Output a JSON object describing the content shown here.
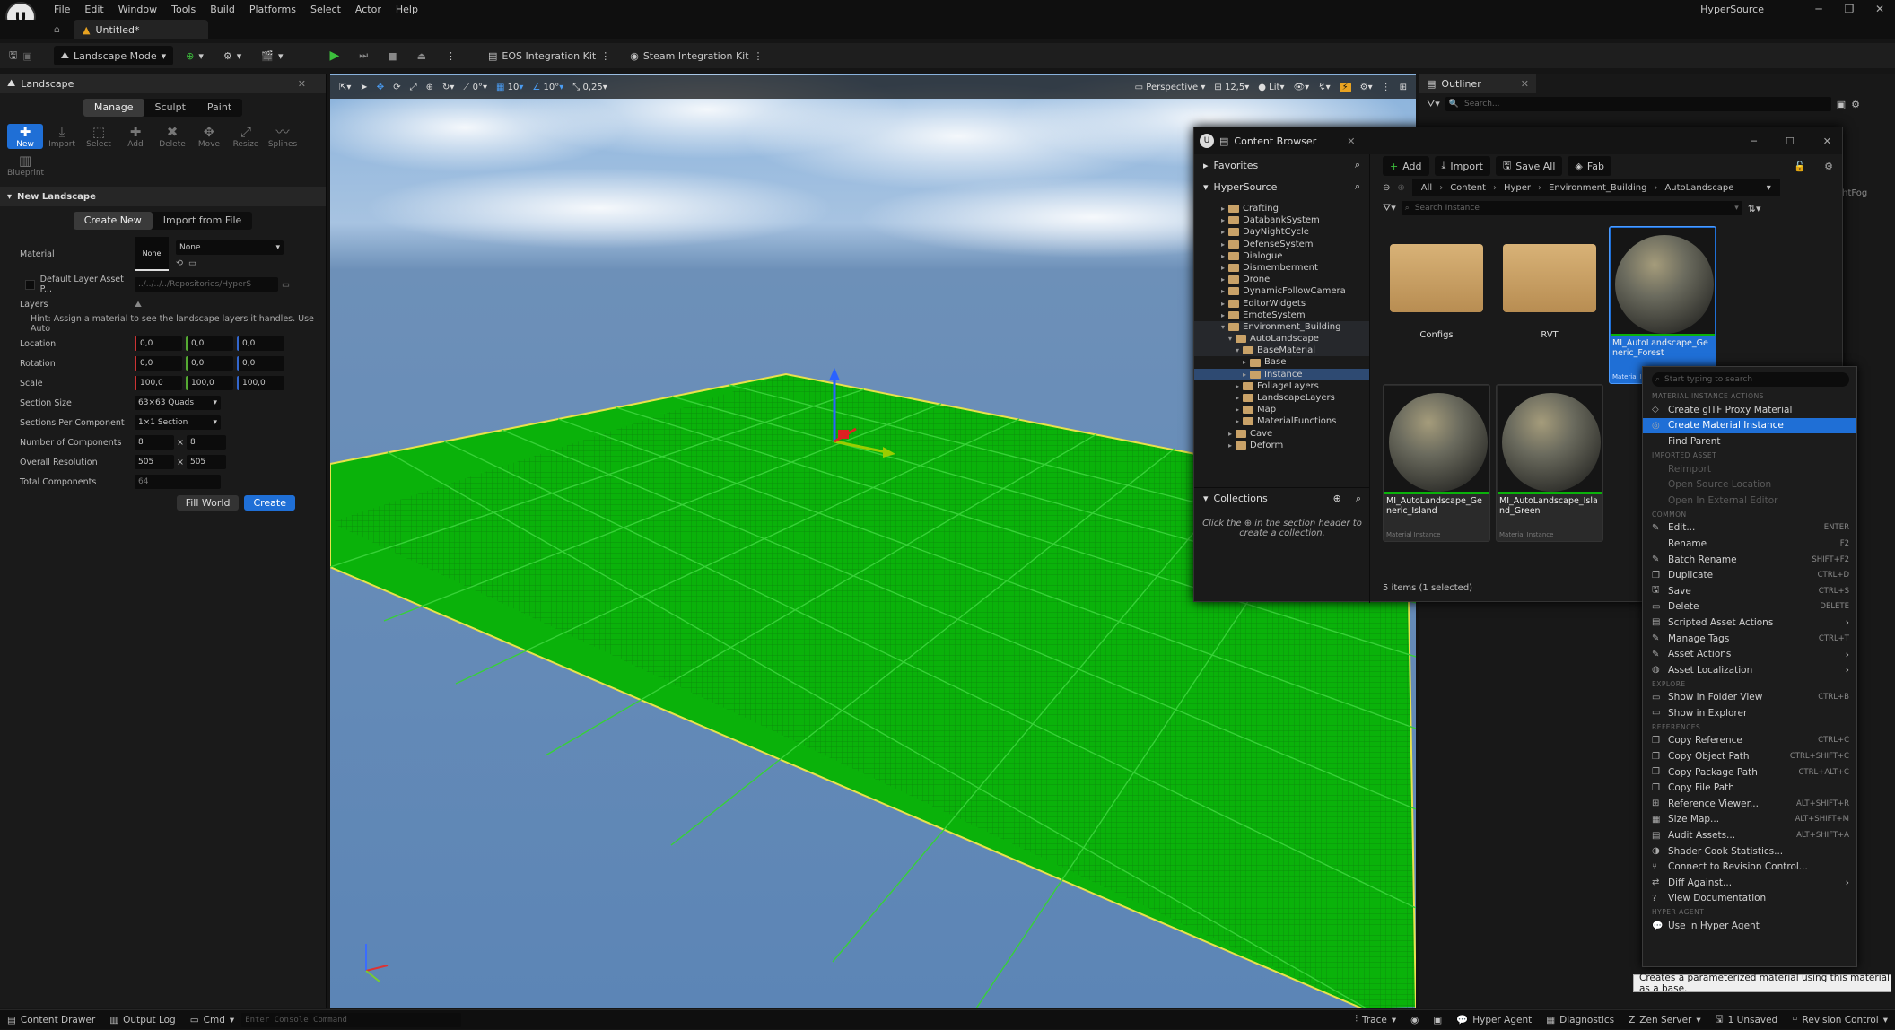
{
  "app": {
    "logo_text": "U",
    "project_name": "HyperSource",
    "doc_tab": "Untitled*"
  },
  "menu": [
    "File",
    "Edit",
    "Window",
    "Tools",
    "Build",
    "Platforms",
    "Select",
    "Actor",
    "Help"
  ],
  "toolbar": {
    "mode_label": "Landscape Mode",
    "eos_label": "EOS Integration Kit",
    "steam_label": "Steam Integration Kit"
  },
  "landscape_panel": {
    "tab_title": "Landscape",
    "modes": [
      "Manage",
      "Sculpt",
      "Paint"
    ],
    "tools": [
      "New",
      "Import",
      "Select",
      "Add",
      "Delete",
      "Move",
      "Resize",
      "Splines"
    ],
    "tool_blueprint": "Blueprint",
    "section_title": "New Landscape",
    "create_tabs": [
      "Create New",
      "Import from File"
    ],
    "material_label": "Material",
    "material_thumb": "None",
    "material_value": "None",
    "default_layer_label": "Default Layer Asset P...",
    "default_layer_path": "../../../../Repositories/HyperS",
    "layers_label": "Layers",
    "hint": "Hint: Assign a material to see the landscape layers it handles. Use Auto",
    "location_label": "Location",
    "location": [
      "0,0",
      "0,0",
      "0,0"
    ],
    "rotation_label": "Rotation",
    "rotation": [
      "0,0",
      "0,0",
      "0,0"
    ],
    "scale_label": "Scale",
    "scale": [
      "100,0",
      "100,0",
      "100,0"
    ],
    "section_size_label": "Section Size",
    "section_size": "63×63 Quads",
    "sections_per_comp_label": "Sections Per Component",
    "sections_per_comp": "1×1 Section",
    "num_components_label": "Number of Components",
    "num_components": [
      "8",
      "8"
    ],
    "overall_res_label": "Overall Resolution",
    "overall_res": [
      "505",
      "505"
    ],
    "total_components_label": "Total Components",
    "total_components": "64",
    "fill_world": "Fill World",
    "create": "Create"
  },
  "viewport": {
    "perspective": "Perspective",
    "lit": "Lit",
    "grid_snap": "10",
    "rot_snap": "10°",
    "scale_snap": "0,25",
    "fov": "12,5",
    "angle": "0°"
  },
  "outliner": {
    "title": "Outliner",
    "search_placeholder": "Search...",
    "partial_item": "ightFog"
  },
  "content_browser": {
    "title": "Content Browser",
    "favorites": "Favorites",
    "root": "HyperSource",
    "tree": [
      {
        "label": "Crafting",
        "depth": 0
      },
      {
        "label": "DatabankSystem",
        "depth": 0
      },
      {
        "label": "DayNightCycle",
        "depth": 0
      },
      {
        "label": "DefenseSystem",
        "depth": 0
      },
      {
        "label": "Dialogue",
        "depth": 0
      },
      {
        "label": "Dismemberment",
        "depth": 0
      },
      {
        "label": "Drone",
        "depth": 0
      },
      {
        "label": "DynamicFollowCamera",
        "depth": 0
      },
      {
        "label": "EditorWidgets",
        "depth": 0
      },
      {
        "label": "EmoteSystem",
        "depth": 0
      },
      {
        "label": "Environment_Building",
        "depth": 0
      },
      {
        "label": "AutoLandscape",
        "depth": 1
      },
      {
        "label": "BaseMaterial",
        "depth": 2
      },
      {
        "label": "Base",
        "depth": 3
      },
      {
        "label": "Instance",
        "depth": 3
      },
      {
        "label": "FoliageLayers",
        "depth": 2
      },
      {
        "label": "LandscapeLayers",
        "depth": 2
      },
      {
        "label": "Map",
        "depth": 2
      },
      {
        "label": "MaterialFunctions",
        "depth": 2
      },
      {
        "label": "Cave",
        "depth": 1
      },
      {
        "label": "Deform",
        "depth": 1
      }
    ],
    "collections": "Collections",
    "collections_hint": "Click the ⊕ in the section header to create a collection.",
    "add": "Add",
    "import": "Import",
    "save_all": "Save All",
    "fab": "Fab",
    "breadcrumb": [
      "All",
      "Content",
      "Hyper",
      "Environment_Building",
      "AutoLandscape"
    ],
    "search_placeholder": "Search Instance",
    "assets": [
      {
        "name": "Configs",
        "type": "folder"
      },
      {
        "name": "RVT",
        "type": "folder"
      },
      {
        "name": "MI_AutoLandscape_Generic_Forest",
        "type": "Material Instance"
      },
      {
        "name": "MI_AutoLandscape_Generic_Island",
        "type": "Material Instance"
      },
      {
        "name": "MI_AutoLandscape_Island_Green",
        "type": "Material Instance"
      }
    ],
    "status": "5 items (1 selected)"
  },
  "context_menu": {
    "search_placeholder": "Start typing to search",
    "sections": [
      {
        "header": "MATERIAL INSTANCE ACTIONS",
        "items": [
          {
            "label": "Create glTF Proxy Material",
            "icon": "gltf-icon"
          },
          {
            "label": "Create Material Instance",
            "icon": "material-instance-icon",
            "hl": true
          },
          {
            "label": "Find Parent",
            "icon": ""
          }
        ]
      },
      {
        "header": "IMPORTED ASSET",
        "items": [
          {
            "label": "Reimport",
            "icon": "",
            "dis": true
          },
          {
            "label": "Open Source Location",
            "icon": "",
            "dis": true
          },
          {
            "label": "Open In External Editor",
            "icon": "",
            "dis": true
          }
        ]
      },
      {
        "header": "COMMON",
        "items": [
          {
            "label": "Edit...",
            "icon": "edit-icon",
            "sc": "ENTER"
          },
          {
            "label": "Rename",
            "icon": "",
            "sc": "F2"
          },
          {
            "label": "Batch Rename",
            "icon": "batch-rename-icon",
            "sc": "SHIFT+F2"
          },
          {
            "label": "Duplicate",
            "icon": "duplicate-icon",
            "sc": "CTRL+D"
          },
          {
            "label": "Save",
            "icon": "save-icon",
            "sc": "CTRL+S"
          },
          {
            "label": "Delete",
            "icon": "delete-icon",
            "sc": "DELETE"
          },
          {
            "label": "Scripted Asset Actions",
            "icon": "script-icon",
            "sub": true
          },
          {
            "label": "Manage Tags",
            "icon": "tag-icon",
            "sc": "CTRL+T"
          },
          {
            "label": "Asset Actions",
            "icon": "wrench-icon",
            "sub": true
          },
          {
            "label": "Asset Localization",
            "icon": "globe-icon",
            "sub": true
          }
        ]
      },
      {
        "header": "EXPLORE",
        "items": [
          {
            "label": "Show in Folder View",
            "icon": "folder-icon",
            "sc": "CTRL+B"
          },
          {
            "label": "Show in Explorer",
            "icon": "folder-icon"
          }
        ]
      },
      {
        "header": "REFERENCES",
        "items": [
          {
            "label": "Copy Reference",
            "icon": "copy-icon",
            "sc": "CTRL+C"
          },
          {
            "label": "Copy Object Path",
            "icon": "copy-icon",
            "sc": "CTRL+SHIFT+C"
          },
          {
            "label": "Copy Package Path",
            "icon": "copy-icon",
            "sc": "CTRL+ALT+C"
          },
          {
            "label": "Copy File Path",
            "icon": "copy-icon"
          },
          {
            "label": "Reference Viewer...",
            "icon": "reference-icon",
            "sc": "ALT+SHIFT+R"
          },
          {
            "label": "Size Map...",
            "icon": "sizemap-icon",
            "sc": "ALT+SHIFT+M"
          },
          {
            "label": "Audit Assets...",
            "icon": "audit-icon",
            "sc": "ALT+SHIFT+A"
          },
          {
            "label": "Shader Cook Statistics...",
            "icon": "stats-icon"
          },
          {
            "label": "Connect to Revision Control...",
            "icon": "revision-icon"
          },
          {
            "label": "Diff Against...",
            "icon": "diff-icon",
            "sub": true
          },
          {
            "label": "View Documentation",
            "icon": "help-icon"
          }
        ]
      },
      {
        "header": "HYPER AGENT",
        "items": [
          {
            "label": "Use in Hyper Agent",
            "icon": "agent-icon"
          }
        ]
      }
    ]
  },
  "tooltip": "Creates a parameterized material using this material as a base.",
  "statusbar": {
    "content_drawer": "Content Drawer",
    "output_log": "Output Log",
    "cmd": "Cmd",
    "console_placeholder": "Enter Console Command",
    "trace": "Trace",
    "hyper_agent": "Hyper Agent",
    "diagnostics": "Diagnostics",
    "zen_server": "Zen Server",
    "unsaved": "1 Unsaved",
    "revision": "Revision Control"
  },
  "colors": {
    "accent": "#1f6fd6",
    "landscape": "#0ab20a",
    "folder": "#c9a268"
  }
}
